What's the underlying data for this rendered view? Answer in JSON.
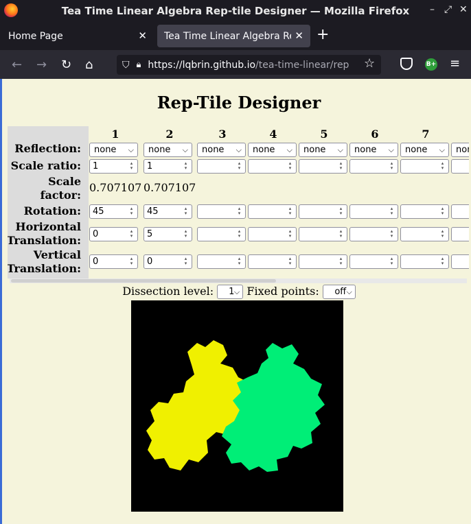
{
  "window": {
    "title": "Tea Time Linear Algebra Rep-tile Designer — Mozilla Firefox",
    "controls": [
      "–",
      "⤢",
      "✕"
    ]
  },
  "tabs": [
    {
      "label": "Home Page",
      "active": false
    },
    {
      "label": "Tea Time Linear Algebra Rep-tile Designer",
      "active": true
    }
  ],
  "url": {
    "host": "https://lqbrin.github.io",
    "path": "/tea-time-linear/rep"
  },
  "page": {
    "title": "Rep-Tile Designer",
    "columns": [
      "1",
      "2",
      "3",
      "4",
      "5",
      "6",
      "7"
    ],
    "row_labels": {
      "reflection": "Reflection:",
      "scale_ratio": "Scale ratio:",
      "scale_factor_1": "Scale",
      "scale_factor_2": "factor:",
      "rotation": "Rotation:",
      "htrans_1": "Horizontal",
      "htrans_2": "Translation:",
      "vtrans_1": "Vertical",
      "vtrans_2": "Translation:"
    },
    "reflection": [
      "none",
      "none",
      "none",
      "none",
      "none",
      "none",
      "none",
      "non"
    ],
    "scale_ratio": [
      "1",
      "1",
      "",
      "",
      "",
      "",
      "",
      ""
    ],
    "scale_factor": [
      "0.707107",
      "0.707107"
    ],
    "rotation": [
      "45",
      "45",
      "",
      "",
      "",
      "",
      "",
      ""
    ],
    "horizontal_translation": [
      "0",
      "5",
      "",
      "",
      "",
      "",
      "",
      ""
    ],
    "vertical_translation": [
      "0",
      "0",
      "",
      "",
      "",
      "",
      "",
      ""
    ],
    "dissection_label": "Dissection level:",
    "dissection_value": "1",
    "fixed_points_label": "Fixed points:",
    "fixed_points_value": "off"
  },
  "colors": {
    "tile_a": "#f0f000",
    "tile_b": "#00ee77",
    "canvas_bg": "#000000",
    "page_bg": "#f5f4dc"
  }
}
